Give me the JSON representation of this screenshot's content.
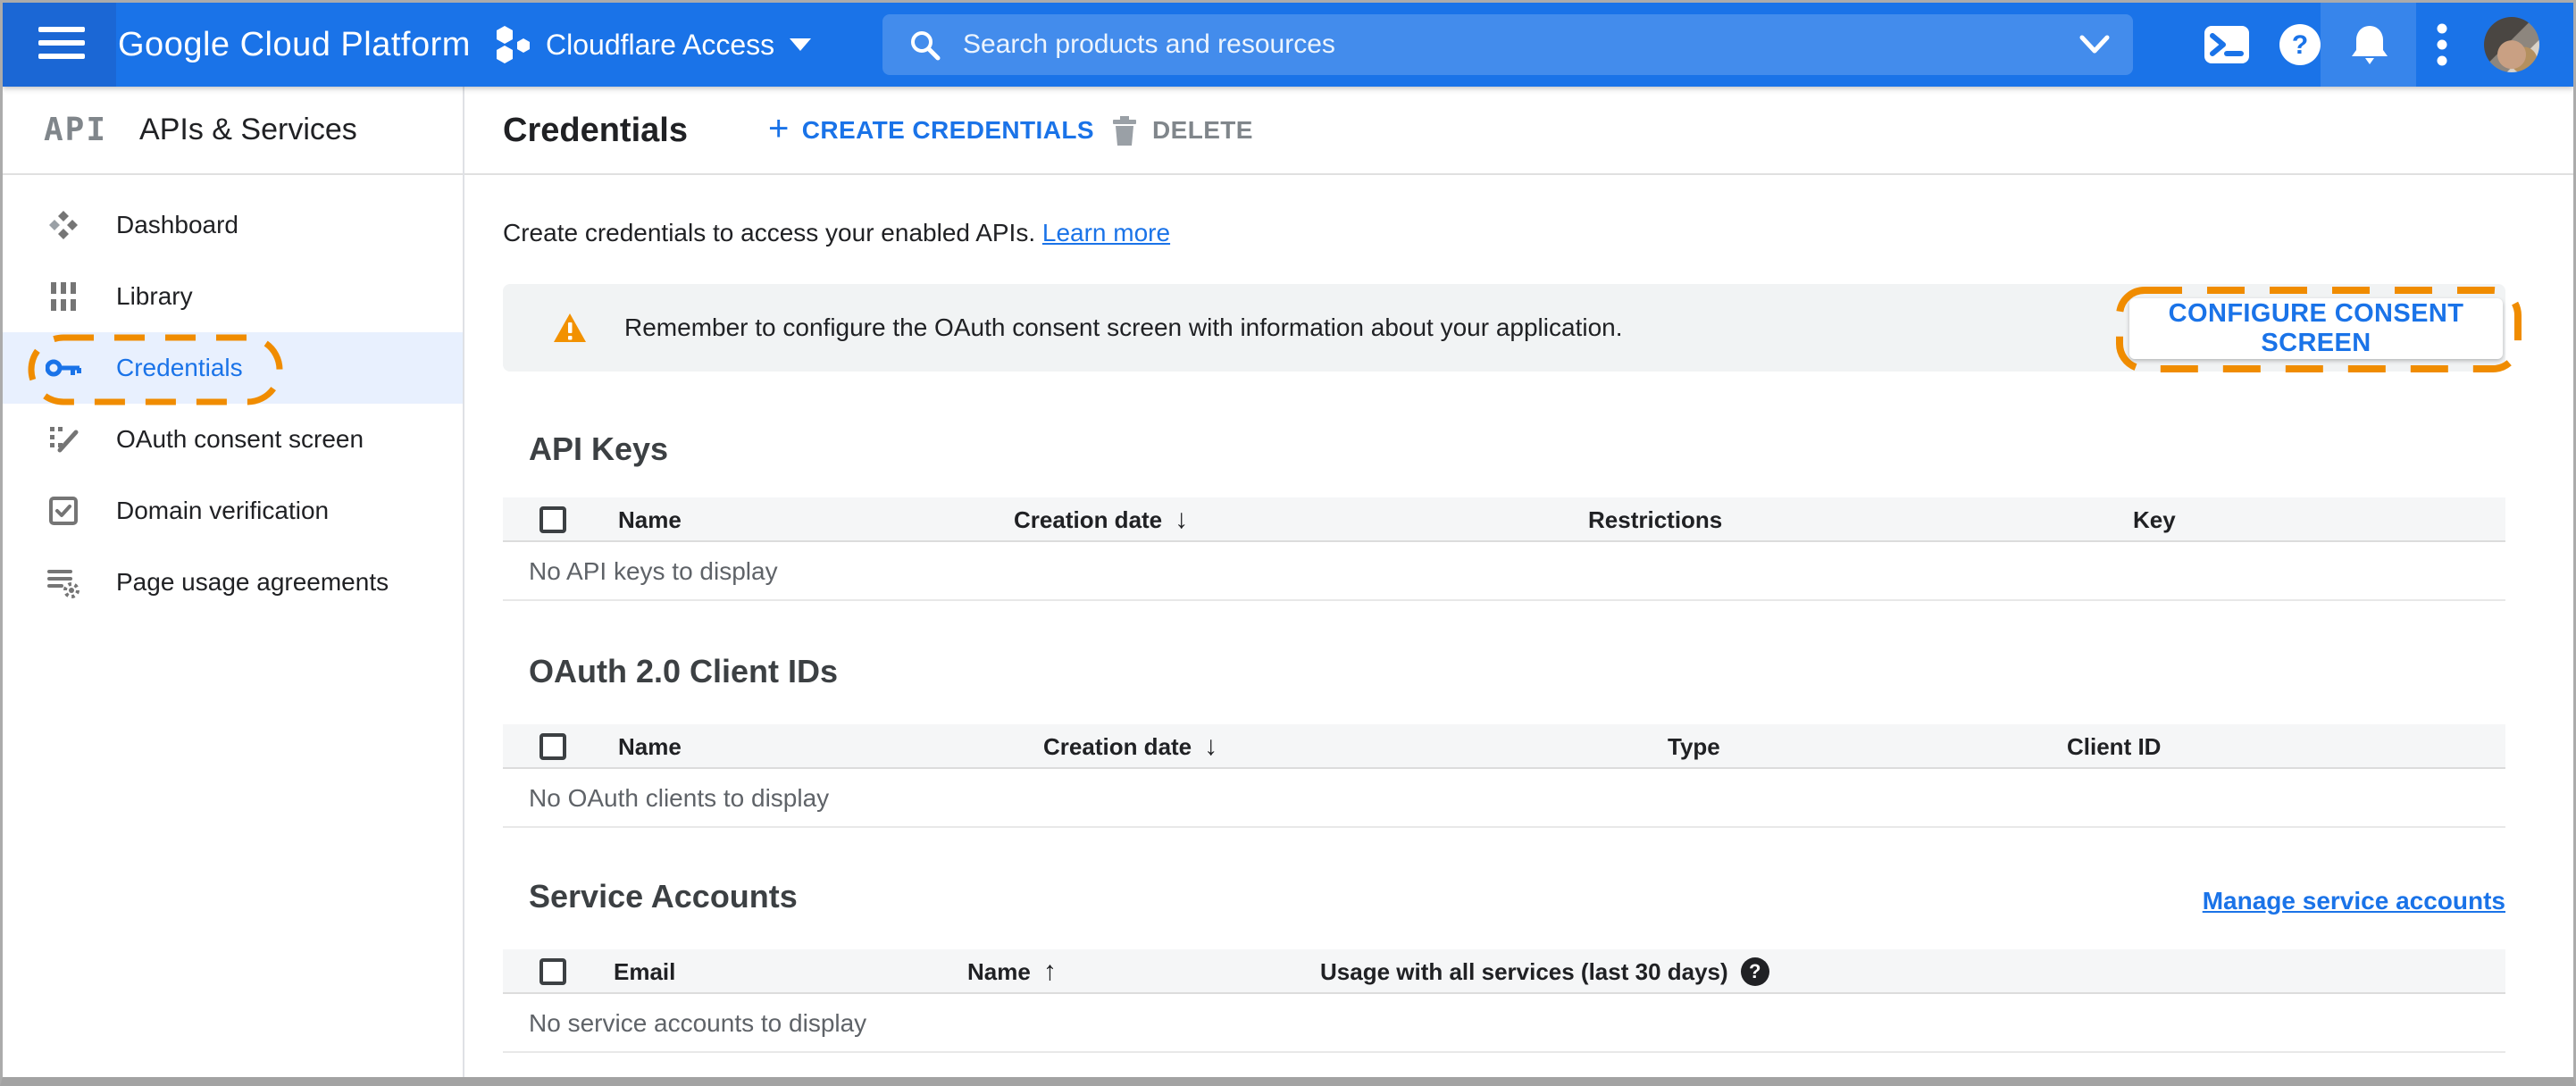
{
  "header": {
    "brand": "Google Cloud Platform",
    "project_name": "Cloudflare Access",
    "search_placeholder": "Search products and resources"
  },
  "sidebar": {
    "logo_text": "API",
    "title": "APIs & Services",
    "items": [
      {
        "label": "Dashboard"
      },
      {
        "label": "Library"
      },
      {
        "label": "Credentials"
      },
      {
        "label": "OAuth consent screen"
      },
      {
        "label": "Domain verification"
      },
      {
        "label": "Page usage agreements"
      }
    ]
  },
  "toolbar": {
    "title": "Credentials",
    "create_label": "CREATE CREDENTIALS",
    "delete_label": "DELETE"
  },
  "intro": {
    "text": "Create credentials to access your enabled APIs.",
    "link_label": "Learn more"
  },
  "banner": {
    "message": "Remember to configure the OAuth consent screen with information about your application.",
    "action_label": "CONFIGURE CONSENT SCREEN"
  },
  "api_keys": {
    "title": "API Keys",
    "columns": {
      "name": "Name",
      "creation_date": "Creation date",
      "restrictions": "Restrictions",
      "key": "Key"
    },
    "sort": "Creation date descending",
    "empty_text": "No API keys to display"
  },
  "oauth_clients": {
    "title": "OAuth 2.0 Client IDs",
    "columns": {
      "name": "Name",
      "creation_date": "Creation date",
      "type": "Type",
      "client_id": "Client ID"
    },
    "sort": "Creation date descending",
    "empty_text": "No OAuth clients to display"
  },
  "service_accounts": {
    "title": "Service Accounts",
    "manage_link_label": "Manage service accounts",
    "columns": {
      "email": "Email",
      "name": "Name",
      "usage": "Usage with all services (last 30 days)"
    },
    "sort": "Name ascending",
    "empty_text": "No service accounts to display"
  },
  "icons": {
    "sort_desc": "↓",
    "sort_asc": "↑",
    "help_q": "?",
    "plus": "+"
  },
  "colors": {
    "header_blue": "#1a73e8",
    "accent_blue": "#1a73e8",
    "warning_orange": "#f29100",
    "annotation_orange": "#f08c00",
    "active_item_bg": "#e8f0fe"
  }
}
